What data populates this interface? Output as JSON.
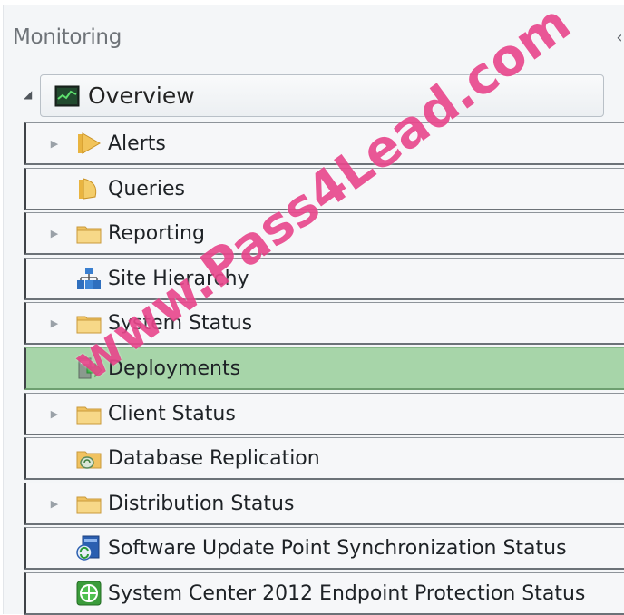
{
  "panel": {
    "title": "Monitoring",
    "collapse_glyph": "‹"
  },
  "overview": {
    "label": "Overview",
    "icon": "monitor-icon",
    "expanded": true
  },
  "tree": {
    "items": [
      {
        "label": "Alerts",
        "icon": "alert-folder-icon",
        "expandable": true,
        "selected": false
      },
      {
        "label": "Queries",
        "icon": "query-folder-icon",
        "expandable": false,
        "selected": false
      },
      {
        "label": "Reporting",
        "icon": "folder-icon",
        "expandable": true,
        "selected": false
      },
      {
        "label": "Site Hierarchy",
        "icon": "site-hierarchy-icon",
        "expandable": false,
        "selected": false
      },
      {
        "label": "System Status",
        "icon": "folder-icon",
        "expandable": true,
        "selected": false
      },
      {
        "label": "Deployments",
        "icon": "deployment-icon",
        "expandable": false,
        "selected": true
      },
      {
        "label": "Client Status",
        "icon": "folder-icon",
        "expandable": true,
        "selected": false
      },
      {
        "label": "Database Replication",
        "icon": "database-folder-icon",
        "expandable": false,
        "selected": false
      },
      {
        "label": "Distribution Status",
        "icon": "folder-icon",
        "expandable": true,
        "selected": false
      },
      {
        "label": "Software Update Point Synchronization Status",
        "icon": "software-update-sync-icon",
        "expandable": false,
        "selected": false
      },
      {
        "label": "System Center 2012 Endpoint Protection Status",
        "icon": "endpoint-protection-icon",
        "expandable": false,
        "selected": false
      }
    ]
  },
  "watermark": "www.Pass4Lead.com",
  "colors": {
    "selected_row": "#a7d5a9",
    "folder": "#f5c86a",
    "watermark": "#e42878"
  }
}
